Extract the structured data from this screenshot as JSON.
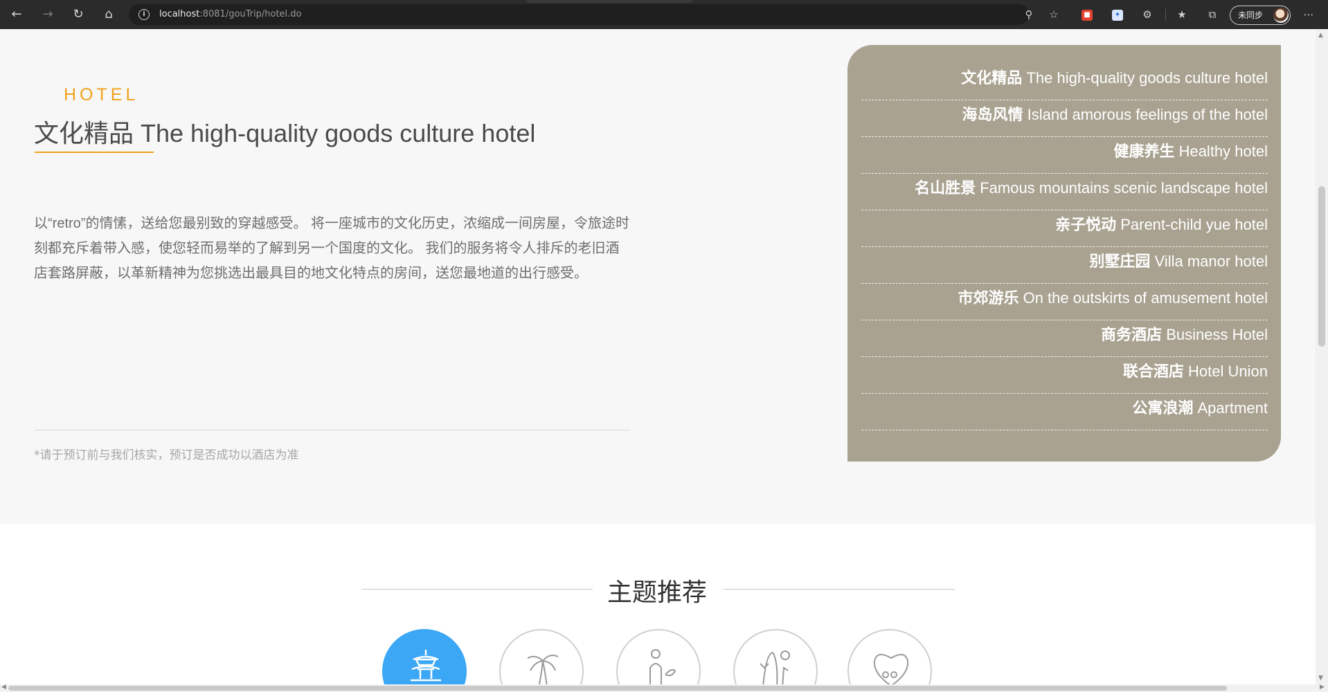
{
  "browser": {
    "url_host": "localhost",
    "url_path": ":8081/gouTrip/hotel.do",
    "profile_label": "未同步",
    "icons": [
      "back-icon",
      "forward-icon",
      "reload-icon",
      "home-icon",
      "info-icon",
      "zoom-icon",
      "add-favorite-icon",
      "extension-icon",
      "favorites-icon",
      "collections-icon",
      "more-icon"
    ]
  },
  "hero": {
    "eyebrow": "HOTEL",
    "title": "文化精品 The high-quality goods culture hotel",
    "intro": "以“retro”的情愫，送给您最别致的穿越感受。 将一座城市的文化历史，浓缩成一间房屋，令旅途时刻都充斥着带入感，使您轻而易举的了解到另一个国度的文化。 我们的服务将令人排斥的老旧酒店套路屏蔽，以革新精神为您挑选出最具目的地文化特点的房间，送您最地道的出行感受。",
    "notice": "*请于预订前与我们核实，预订是否成功以酒店为准"
  },
  "categories": [
    {
      "zh": "文化精品",
      "en": "The high-quality goods culture hotel"
    },
    {
      "zh": "海岛风情",
      "en": "Island amorous feelings of the hotel"
    },
    {
      "zh": "健康养生",
      "en": "Healthy hotel"
    },
    {
      "zh": "名山胜景",
      "en": "Famous mountains scenic landscape hotel"
    },
    {
      "zh": "亲子悦动",
      "en": "Parent-child yue hotel"
    },
    {
      "zh": "别墅庄园",
      "en": "Villa manor hotel"
    },
    {
      "zh": "市郊游乐",
      "en": "On the outskirts of amusement hotel"
    },
    {
      "zh": "商务酒店",
      "en": "Business Hotel"
    },
    {
      "zh": "联合酒店",
      "en": "Hotel Union"
    },
    {
      "zh": "公寓浪潮",
      "en": "Apartment"
    }
  ],
  "themes": {
    "title": "主题推荐",
    "icons": [
      "pagoda-icon",
      "palm-tree-icon",
      "person-plant-icon",
      "cactus-icon",
      "heart-icon"
    ]
  },
  "colors": {
    "accent": "#f0a21b",
    "panel": "#a9a291",
    "active_theme": "#3ca7f5"
  }
}
